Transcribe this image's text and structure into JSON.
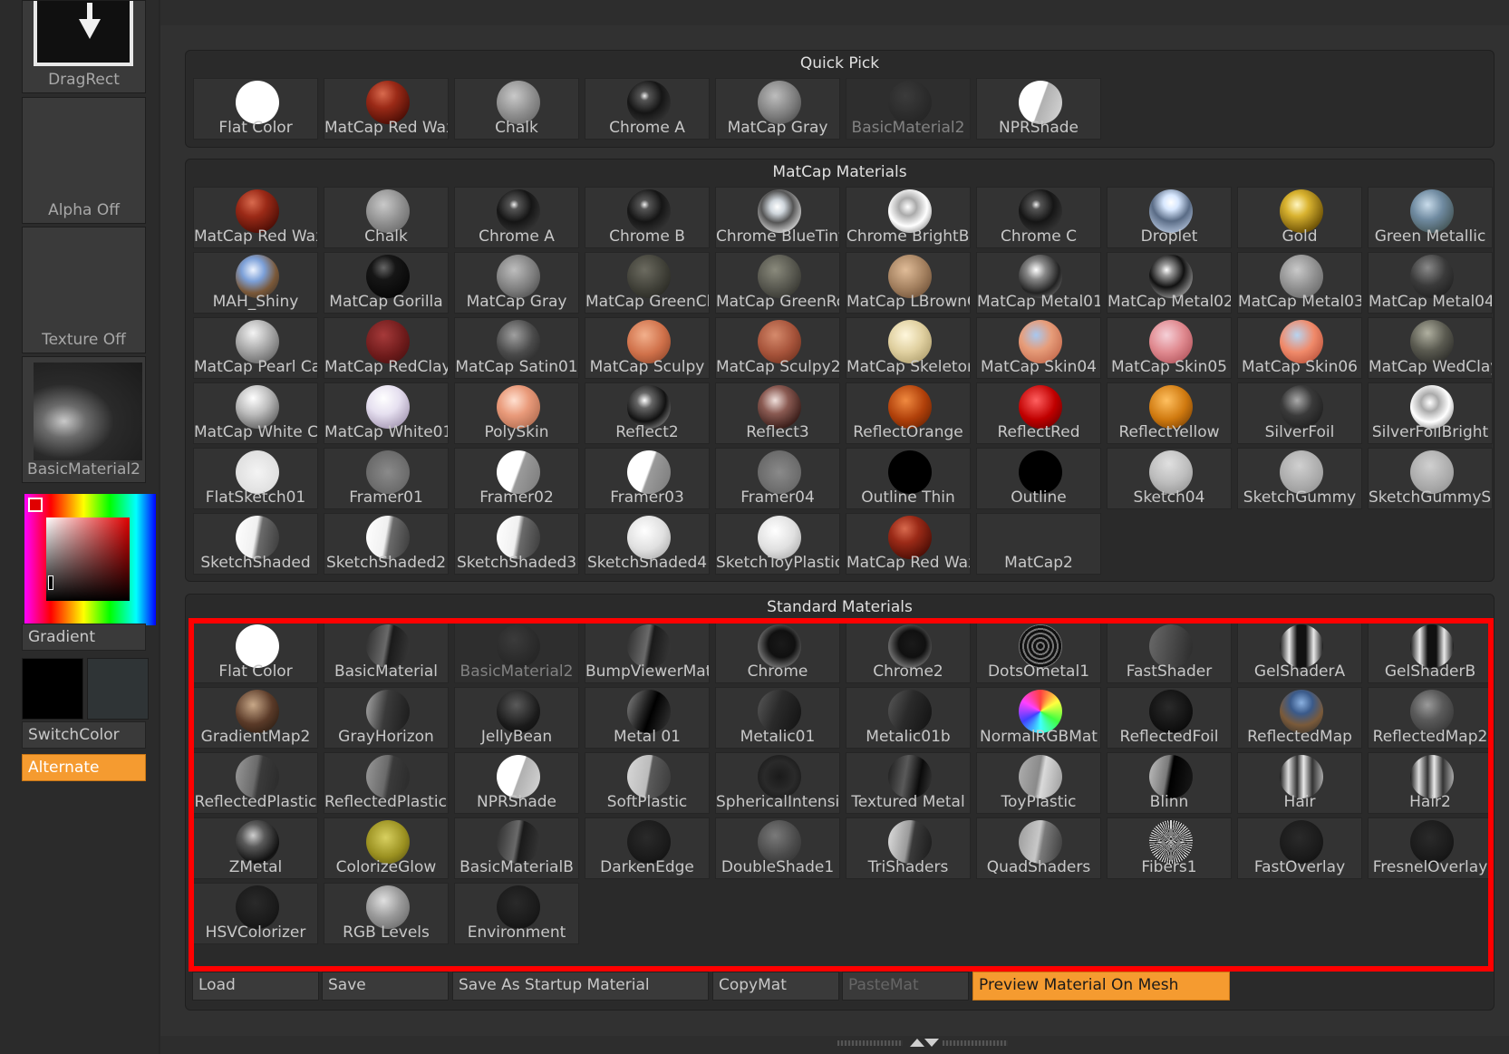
{
  "left_panel": {
    "dragrect_label": "DragRect",
    "alpha_label": "Alpha Off",
    "texture_label": "Texture Off",
    "material_thumb_label": "BasicMaterial2",
    "gradient_label": "Gradient",
    "switchcolor_label": "SwitchColor",
    "alternate_label": "Alternate",
    "main_color": "#000000",
    "secondary_color": "#2f3436"
  },
  "sections": {
    "quick_pick": {
      "title": "Quick Pick",
      "items": [
        {
          "name": "Flat Color",
          "shade": "flat-white"
        },
        {
          "name": "MatCap Red Wax",
          "shade": "red"
        },
        {
          "name": "Chalk",
          "shade": "gray-soft"
        },
        {
          "name": "Chrome A",
          "shade": "chrome-dark"
        },
        {
          "name": "MatCap Gray",
          "shade": "gray"
        },
        {
          "name": "BasicMaterial2",
          "shade": "dark-basic",
          "disabled": true
        },
        {
          "name": "NPRShade",
          "shade": "npr"
        }
      ]
    },
    "matcap": {
      "title": "MatCap Materials",
      "items": [
        {
          "name": "MatCap Red Wax",
          "shade": "red"
        },
        {
          "name": "Chalk",
          "shade": "gray-soft"
        },
        {
          "name": "Chrome A",
          "shade": "chrome-dark"
        },
        {
          "name": "Chrome B",
          "shade": "chrome-dark"
        },
        {
          "name": "Chrome BlueTint",
          "shade": "chrome-light"
        },
        {
          "name": "Chrome BrightBl",
          "shade": "chrome-bright"
        },
        {
          "name": "Chrome C",
          "shade": "chrome-dark"
        },
        {
          "name": "Droplet",
          "shade": "droplet"
        },
        {
          "name": "Gold",
          "shade": "gold"
        },
        {
          "name": "Green Metallic",
          "shade": "green-metal"
        },
        {
          "name": "MAH_Shiny",
          "shade": "mah"
        },
        {
          "name": "MatCap Gorilla",
          "shade": "black-gloss"
        },
        {
          "name": "MatCap Gray",
          "shade": "gray"
        },
        {
          "name": "MatCap GreenCl",
          "shade": "olive-dark"
        },
        {
          "name": "MatCap GreenRo",
          "shade": "olive"
        },
        {
          "name": "MatCap LBrownC",
          "shade": "lbrown"
        },
        {
          "name": "MatCap Metal01",
          "shade": "metal01"
        },
        {
          "name": "MatCap Metal02",
          "shade": "metal02"
        },
        {
          "name": "MatCap Metal03",
          "shade": "gray-soft"
        },
        {
          "name": "MatCap Metal04",
          "shade": "dark-metal"
        },
        {
          "name": "MatCap Pearl Cav",
          "shade": "pearl"
        },
        {
          "name": "MatCap RedClay",
          "shade": "redclay"
        },
        {
          "name": "MatCap Satin01",
          "shade": "satin"
        },
        {
          "name": "MatCap Sculpy",
          "shade": "sculpy"
        },
        {
          "name": "MatCap Sculpy2",
          "shade": "sculpy2"
        },
        {
          "name": "MatCap Skeleton",
          "shade": "skeleton"
        },
        {
          "name": "MatCap Skin04",
          "shade": "skin04"
        },
        {
          "name": "MatCap Skin05",
          "shade": "skin05"
        },
        {
          "name": "MatCap Skin06",
          "shade": "skin06"
        },
        {
          "name": "MatCap WedClay",
          "shade": "wedclay"
        },
        {
          "name": "MatCap White Cav",
          "shade": "white-cav"
        },
        {
          "name": "MatCap White01",
          "shade": "white01"
        },
        {
          "name": "PolySkin",
          "shade": "polyskin"
        },
        {
          "name": "Reflect2",
          "shade": "reflect2"
        },
        {
          "name": "Reflect3",
          "shade": "reflect3"
        },
        {
          "name": "ReflectOrange",
          "shade": "orange"
        },
        {
          "name": "ReflectRed",
          "shade": "reflect-red"
        },
        {
          "name": "ReflectYellow",
          "shade": "reflect-yellow"
        },
        {
          "name": "SilverFoil",
          "shade": "silverfoil"
        },
        {
          "name": "SilverFoilBright",
          "shade": "chrome-bright"
        },
        {
          "name": "FlatSketch01",
          "shade": "flatsketch"
        },
        {
          "name": "Framer01",
          "shade": "framer"
        },
        {
          "name": "Framer02",
          "shade": "framer-half"
        },
        {
          "name": "Framer03",
          "shade": "framer-half"
        },
        {
          "name": "Framer04",
          "shade": "framer"
        },
        {
          "name": "Outline Thin",
          "shade": "outline-thin"
        },
        {
          "name": "Outline",
          "shade": "outline"
        },
        {
          "name": "Sketch04",
          "shade": "sketch04"
        },
        {
          "name": "SketchGummy",
          "shade": "gummy"
        },
        {
          "name": "SketchGummyShaded",
          "shade": "gummy"
        },
        {
          "name": "SketchShaded",
          "shade": "sketch-shaded"
        },
        {
          "name": "SketchShaded2",
          "shade": "sketch-shaded"
        },
        {
          "name": "SketchShaded3",
          "shade": "sketch-shaded"
        },
        {
          "name": "SketchShaded4",
          "shade": "sketch-light"
        },
        {
          "name": "SketchToyPlastic",
          "shade": "sketch-light"
        },
        {
          "name": "MatCap Red Wax",
          "shade": "red"
        },
        {
          "name": "MatCap2",
          "shade": "none"
        }
      ]
    },
    "standard": {
      "title": "Standard Materials",
      "items": [
        {
          "name": "Flat Color",
          "shade": "flat-white"
        },
        {
          "name": "BasicMaterial",
          "shade": "basic"
        },
        {
          "name": "BasicMaterial2",
          "shade": "dark-basic",
          "disabled": true
        },
        {
          "name": "BumpViewerMat",
          "shade": "basic"
        },
        {
          "name": "Chrome",
          "shade": "chrome-std"
        },
        {
          "name": "Chrome2",
          "shade": "chrome-std"
        },
        {
          "name": "DotsOmetal1",
          "shade": "dots"
        },
        {
          "name": "FastShader",
          "shade": "fastshader"
        },
        {
          "name": "GelShaderA",
          "shade": "gel"
        },
        {
          "name": "GelShaderB",
          "shade": "gel"
        },
        {
          "name": "GradientMap2",
          "shade": "gradientmap"
        },
        {
          "name": "GrayHorizon",
          "shade": "grayhorizon"
        },
        {
          "name": "JellyBean",
          "shade": "jelly"
        },
        {
          "name": "Metal 01",
          "shade": "metal-std"
        },
        {
          "name": "Metalic01",
          "shade": "metalic"
        },
        {
          "name": "Metalic01b",
          "shade": "metalic"
        },
        {
          "name": "NormalRGBMat",
          "shade": "normalrgb"
        },
        {
          "name": "ReflectedFoil",
          "shade": "foil"
        },
        {
          "name": "ReflectedMap",
          "shade": "reflectedmap"
        },
        {
          "name": "ReflectedMap2",
          "shade": "reflectedmap2"
        },
        {
          "name": "ReflectedPlastic",
          "shade": "refplastic"
        },
        {
          "name": "ReflectedPlasticB",
          "shade": "refplastic"
        },
        {
          "name": "NPRShade",
          "shade": "npr"
        },
        {
          "name": "SoftPlastic",
          "shade": "softplastic"
        },
        {
          "name": "SphericalIntensity",
          "shade": "spherical"
        },
        {
          "name": "Textured Metal",
          "shade": "texmetal"
        },
        {
          "name": "ToyPlastic",
          "shade": "toyplastic"
        },
        {
          "name": "Blinn",
          "shade": "blinn"
        },
        {
          "name": "Hair",
          "shade": "hair"
        },
        {
          "name": "Hair2",
          "shade": "hair"
        },
        {
          "name": "ZMetal",
          "shade": "zmetal"
        },
        {
          "name": "ColorizeGlow",
          "shade": "colorize"
        },
        {
          "name": "BasicMaterialB",
          "shade": "basic"
        },
        {
          "name": "DarkenEdge",
          "shade": "darkenedge"
        },
        {
          "name": "DoubleShade1",
          "shade": "doubleshade"
        },
        {
          "name": "TriShaders",
          "shade": "trishaders"
        },
        {
          "name": "QuadShaders",
          "shade": "quadshaders"
        },
        {
          "name": "Fibers1",
          "shade": "fibers"
        },
        {
          "name": "FastOverlay",
          "shade": "darkenedge"
        },
        {
          "name": "FresnelOverlay",
          "shade": "darkenedge"
        },
        {
          "name": "HSVColorizer",
          "shade": "darkenedge"
        },
        {
          "name": "RGB Levels",
          "shade": "rgblevels"
        },
        {
          "name": "Environment",
          "shade": "darkenedge"
        }
      ]
    }
  },
  "bottom_buttons": {
    "load": "Load",
    "save": "Save",
    "save_startup": "Save As Startup Material",
    "copymat": "CopyMat",
    "pastemat": "PasteMat",
    "preview": "Preview Material On Mesh"
  },
  "colors": {
    "accent_orange": "#f59b30",
    "highlight_red": "#ff0000"
  }
}
